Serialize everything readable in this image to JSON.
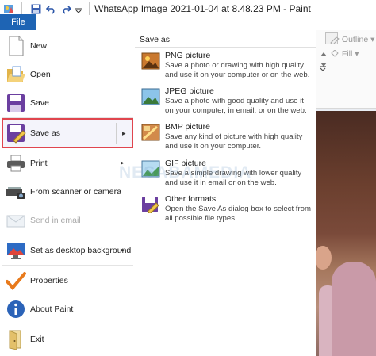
{
  "window": {
    "title": "WhatsApp Image 2021-01-04 at 8.48.23 PM - Paint"
  },
  "ribbon": {
    "file_tab": "File",
    "outline_label": "Outline",
    "fill_label": "Fill"
  },
  "menu": {
    "items": [
      {
        "label": "New",
        "icon": "new-file-icon"
      },
      {
        "label": "Open",
        "icon": "open-folder-icon"
      },
      {
        "label": "Save",
        "icon": "save-floppy-icon"
      },
      {
        "label": "Save as",
        "icon": "save-as-icon",
        "selected": true
      },
      {
        "label": "Print",
        "icon": "printer-icon"
      },
      {
        "label": "From scanner or camera",
        "icon": "scanner-icon"
      },
      {
        "label": "Send in email",
        "icon": "email-icon",
        "disabled": true
      },
      {
        "label": "Set as desktop background",
        "icon": "desktop-icon"
      },
      {
        "label": "Properties",
        "icon": "checkmark-icon"
      },
      {
        "label": "About Paint",
        "icon": "info-icon"
      },
      {
        "label": "Exit",
        "icon": "exit-icon"
      }
    ]
  },
  "submenu": {
    "title": "Save as",
    "items": [
      {
        "name": "PNG picture",
        "desc": "Save a photo or drawing with high quality and use it on your computer or on the web."
      },
      {
        "name": "JPEG picture",
        "desc": "Save a photo with good quality and use it on your computer, in email, or on the web."
      },
      {
        "name": "BMP picture",
        "desc": "Save any kind of picture with high quality and use it on your computer."
      },
      {
        "name": "GIF picture",
        "desc": "Save a simple drawing with lower quality and use it in email or on the web."
      },
      {
        "name": "Other formats",
        "desc": "Open the Save As dialog box to select from all possible file types."
      }
    ]
  },
  "watermark": "NESABAMEDIA",
  "colors": {
    "file_tab": "#1e64b4",
    "selection_border": "#e0454e"
  }
}
